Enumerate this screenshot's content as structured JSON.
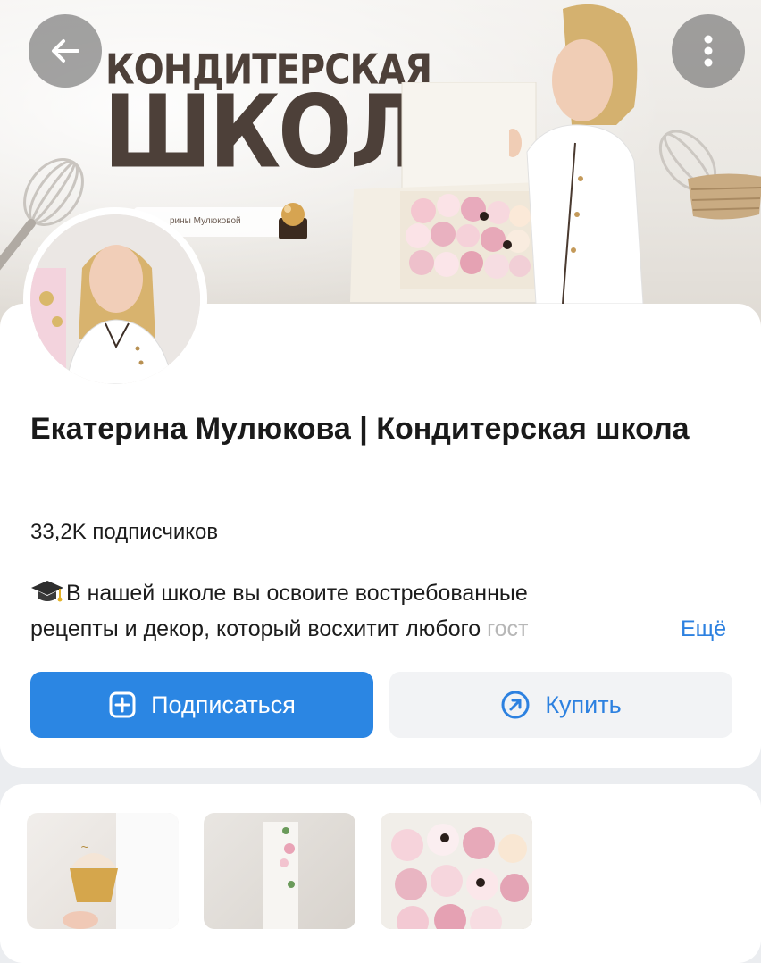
{
  "cover": {
    "title_line1": "КОНДИТЕРСКАЯ",
    "title_line2": "ШКОЛА",
    "caption": "рины Мулюковой"
  },
  "nav": {
    "back_icon": "arrow-left-icon",
    "more_icon": "more-vertical-icon"
  },
  "profile": {
    "name": "Екатерина Мулюкова | Кондитерская школа",
    "subscribers": "33,2K подписчиков",
    "about_icon": "graduation-cap-icon",
    "about_line1": "В нашей школе вы освоите востребованные",
    "about_line2": "рецепты и декор, который восхитит любого ",
    "about_fade": "гост",
    "more_label": "Ещё"
  },
  "actions": {
    "subscribe_label": "Подписаться",
    "subscribe_icon": "plus-square-icon",
    "buy_label": "Купить",
    "buy_icon": "arrow-up-right-circle-icon"
  },
  "colors": {
    "accent": "#2b86e3",
    "link": "#2d81e0",
    "secondary_button_bg": "#f2f3f5",
    "page_bg": "#ebedf0"
  }
}
